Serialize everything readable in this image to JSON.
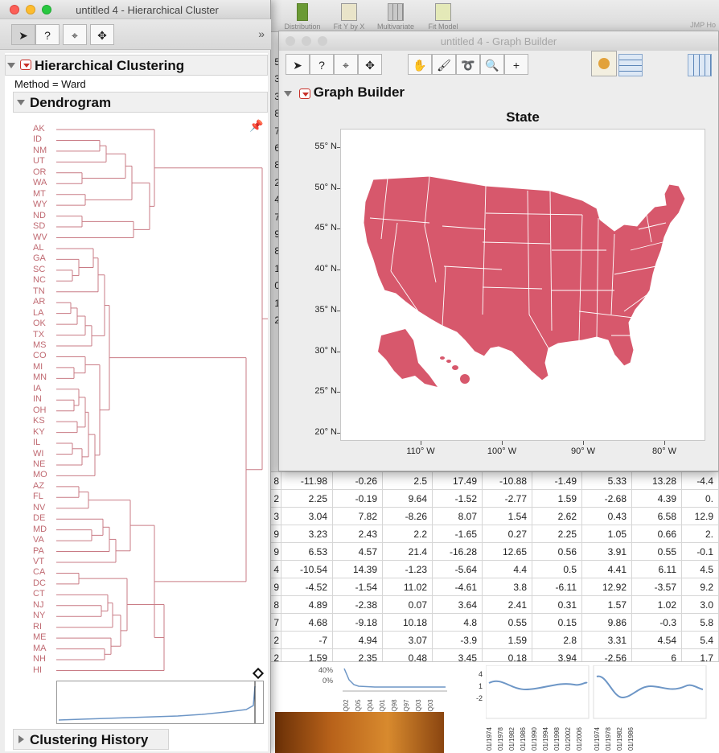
{
  "colors": {
    "dendro": "#c97b85",
    "map_fill": "#d7586c",
    "spark_blue": "#6d96c6",
    "accent_red": "#c8312a"
  },
  "back_window": {
    "title": "JMP Ho",
    "toolbar": [
      {
        "label": "Distribution",
        "icon": "distribution-icon"
      },
      {
        "label": "Fit Y by X",
        "icon": "fit-y-by-x-icon"
      },
      {
        "label": "Multivariate",
        "icon": "multivariate-icon"
      },
      {
        "label": "Fit Model",
        "icon": "fit-model-icon"
      }
    ],
    "row_stub": [
      "5",
      "3",
      "3",
      "8",
      "7",
      "6",
      "8",
      "2",
      "4",
      "7",
      "9",
      "8",
      "1",
      "0",
      "1",
      "2"
    ],
    "table_rows": [
      [
        "8",
        "-11.98",
        "-0.26",
        "2.5",
        "17.49",
        "-10.88",
        "-1.49",
        "5.33",
        "13.28",
        "-4.4"
      ],
      [
        "2",
        "2.25",
        "-0.19",
        "9.64",
        "-1.52",
        "-2.77",
        "1.59",
        "-2.68",
        "4.39",
        "0."
      ],
      [
        "3",
        "3.04",
        "7.82",
        "-8.26",
        "8.07",
        "1.54",
        "2.62",
        "0.43",
        "6.58",
        "12.9"
      ],
      [
        "9",
        "3.23",
        "2.43",
        "2.2",
        "-1.65",
        "0.27",
        "2.25",
        "1.05",
        "0.66",
        "2."
      ],
      [
        "9",
        "6.53",
        "4.57",
        "21.4",
        "-16.28",
        "12.65",
        "0.56",
        "3.91",
        "0.55",
        "-0.1"
      ],
      [
        "4",
        "-10.54",
        "14.39",
        "-1.23",
        "-5.64",
        "4.4",
        "0.5",
        "4.41",
        "6.11",
        "4.5"
      ],
      [
        "9",
        "-4.52",
        "-1.54",
        "11.02",
        "-4.61",
        "3.8",
        "-6.11",
        "12.92",
        "-3.57",
        "9.2"
      ],
      [
        "8",
        "4.89",
        "-2.38",
        "0.07",
        "3.64",
        "2.41",
        "0.31",
        "1.57",
        "1.02",
        "3.0"
      ],
      [
        "7",
        "4.68",
        "-9.18",
        "10.18",
        "4.8",
        "0.55",
        "0.15",
        "9.86",
        "-0.3",
        "5.8"
      ],
      [
        "2",
        "-7",
        "4.94",
        "3.07",
        "-3.9",
        "1.59",
        "2.8",
        "3.31",
        "4.54",
        "5.4"
      ],
      [
        "2",
        "1.59",
        "2.35",
        "0.48",
        "3.45",
        "0.18",
        "3.94",
        "-2.56",
        "6",
        "1.7"
      ]
    ],
    "spark_pct_labels": [
      "40%",
      "0%"
    ],
    "spark_quarters": [
      "3Q02",
      "2Q05",
      "4Q04",
      "3Q01",
      "2Q98",
      "4Q97",
      "3Q03",
      "1Q03"
    ],
    "series_y_ticks": [
      "4",
      "1",
      "-2"
    ],
    "series_dates": [
      "01/1974",
      "01/1978",
      "01/1982",
      "01/1986",
      "01/1990",
      "01/1994",
      "01/1998",
      "01/2002",
      "01/2006"
    ]
  },
  "graph_builder": {
    "window_title": "untitled 4 - Graph Builder",
    "outline_title": "Graph Builder",
    "map_title": "State",
    "tools": [
      "arrow-tool",
      "help-tool",
      "crosshair-tool",
      "move-tool",
      "hand-tool",
      "brush-tool",
      "lasso-tool",
      "zoom-tool",
      "scaler-tool"
    ],
    "y_labels": [
      "55° N",
      "50° N",
      "45° N",
      "40° N",
      "35° N",
      "30° N",
      "25° N",
      "20° N"
    ],
    "x_labels": [
      "110° W",
      "100° W",
      "90° W",
      "80° W"
    ]
  },
  "hier_cluster": {
    "window_title": "untitled 4 - Hierarchical Cluster",
    "section_title": "Hierarchical Clustering",
    "method_text": "Method = Ward",
    "dendrogram_title": "Dendrogram",
    "history_title": "Clustering History",
    "more_chevron": "»",
    "states": [
      "AK",
      "ID",
      "NM",
      "UT",
      "OR",
      "WA",
      "MT",
      "WY",
      "ND",
      "SD",
      "WV",
      "AL",
      "GA",
      "SC",
      "NC",
      "TN",
      "AR",
      "LA",
      "OK",
      "TX",
      "MS",
      "CO",
      "MI",
      "MN",
      "IA",
      "IN",
      "OH",
      "KS",
      "KY",
      "IL",
      "WI",
      "NE",
      "MO",
      "AZ",
      "FL",
      "NV",
      "DE",
      "MD",
      "VA",
      "PA",
      "VT",
      "CA",
      "DC",
      "CT",
      "NJ",
      "NY",
      "RI",
      "ME",
      "MA",
      "NH",
      "HI"
    ]
  }
}
